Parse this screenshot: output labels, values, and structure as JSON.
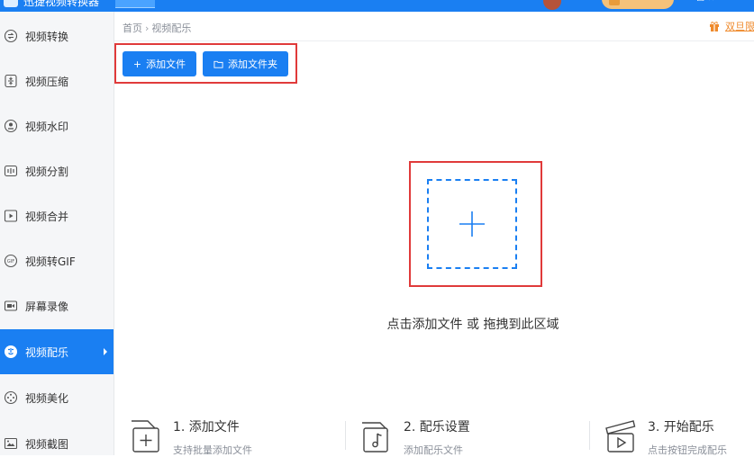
{
  "topbar": {
    "title": "迅捷视频转换器",
    "window_controls": "— ☐ ✕"
  },
  "sidebar": {
    "items": [
      {
        "label": "视频转换",
        "icon": "convert-icon"
      },
      {
        "label": "视频压缩",
        "icon": "compress-icon"
      },
      {
        "label": "视频水印",
        "icon": "watermark-icon"
      },
      {
        "label": "视频分割",
        "icon": "split-icon"
      },
      {
        "label": "视频合并",
        "icon": "merge-icon"
      },
      {
        "label": "视频转GIF",
        "icon": "gif-icon"
      },
      {
        "label": "屏幕录像",
        "icon": "screen-record-icon"
      },
      {
        "label": "视频配乐",
        "icon": "music-icon",
        "active": true
      },
      {
        "label": "视频美化",
        "icon": "beautify-icon"
      },
      {
        "label": "视频截图",
        "icon": "screenshot-icon"
      }
    ]
  },
  "breadcrumb": {
    "home": "首页",
    "separator": "›",
    "current": "视频配乐"
  },
  "promo": {
    "label": "双旦限"
  },
  "toolbar": {
    "add_file_icon": "+",
    "add_file_label": "添加文件",
    "add_folder_icon": "folder-icon",
    "add_folder_label": "添加文件夹"
  },
  "dropzone": {
    "hint": "点击添加文件 或 拖拽到此区域"
  },
  "steps": [
    {
      "title": "1. 添加文件",
      "desc": "支持批量添加文件",
      "icon": "add-file-step-icon"
    },
    {
      "title": "2. 配乐设置",
      "desc": "添加配乐文件",
      "icon": "music-file-step-icon"
    },
    {
      "title": "3. 开始配乐",
      "desc": "点击按钮完成配乐",
      "icon": "start-step-icon"
    }
  ],
  "colors": {
    "accent": "#1a7ff2",
    "highlight_frame": "#e03a3a",
    "promo": "#ef8a2c"
  }
}
